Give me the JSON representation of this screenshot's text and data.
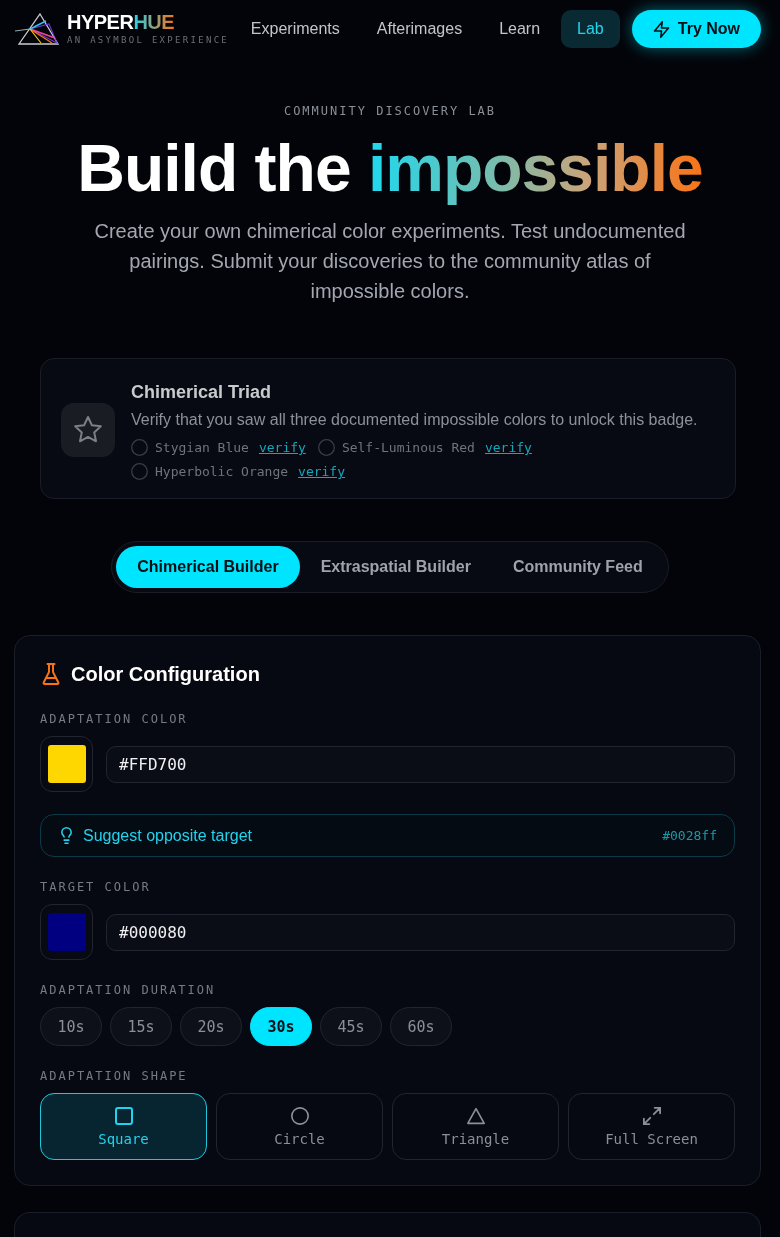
{
  "header": {
    "logo": {
      "wordmark": "HYPER",
      "wordmark_accent": "HUE",
      "tagline": "AN ASYMBOL EXPERIENCE"
    },
    "nav": [
      {
        "label": "Experiments",
        "selected": false
      },
      {
        "label": "Afterimages",
        "selected": false
      },
      {
        "label": "Learn",
        "selected": false
      },
      {
        "label": "Lab",
        "selected": true
      }
    ],
    "cta": "Try Now"
  },
  "hero": {
    "eyebrow": "COMMUNITY DISCOVERY LAB",
    "title": "Build the",
    "title_accent": "impossible",
    "subtitle": "Create your own chimerical color experiments. Test undocumented pairings. Submit your discoveries to the community atlas of impossible colors."
  },
  "badge": {
    "title": "Chimerical Triad",
    "description": "Verify that you saw all three documented impossible colors to unlock this badge.",
    "requirements": [
      {
        "name": "Stygian Blue",
        "action": "verify",
        "checked": false
      },
      {
        "name": "Self-Luminous Red",
        "action": "verify",
        "checked": false
      },
      {
        "name": "Hyperbolic Orange",
        "action": "verify",
        "checked": false
      }
    ]
  },
  "tabs": [
    {
      "label": "Chimerical Builder",
      "selected": true
    },
    {
      "label": "Extraspatial Builder",
      "selected": false
    },
    {
      "label": "Community Feed",
      "selected": false
    }
  ],
  "color_configuration": {
    "title": "Color Configuration",
    "adaptation_color": {
      "label": "ADAPTATION COLOR",
      "value": "#FFD700",
      "color": "#ffd700"
    },
    "suggestion": {
      "label": "Suggest opposite target",
      "value": "#0028ff"
    },
    "target_color": {
      "label": "TARGET COLOR",
      "value": "#000080",
      "color": "#000080"
    },
    "duration": {
      "label": "ADAPTATION DURATION",
      "options": [
        {
          "label": "10s",
          "selected": false
        },
        {
          "label": "15s",
          "selected": false
        },
        {
          "label": "20s",
          "selected": false
        },
        {
          "label": "30s",
          "selected": true
        },
        {
          "label": "45s",
          "selected": false
        },
        {
          "label": "60s",
          "selected": false
        }
      ]
    },
    "shape": {
      "label": "ADAPTATION SHAPE",
      "options": [
        {
          "label": "Square",
          "kind": "square",
          "selected": true
        },
        {
          "label": "Circle",
          "kind": "circle",
          "selected": false
        },
        {
          "label": "Triangle",
          "kind": "triangle",
          "selected": false
        },
        {
          "label": "Full Screen",
          "kind": "fullscreen",
          "selected": false
        }
      ]
    }
  }
}
